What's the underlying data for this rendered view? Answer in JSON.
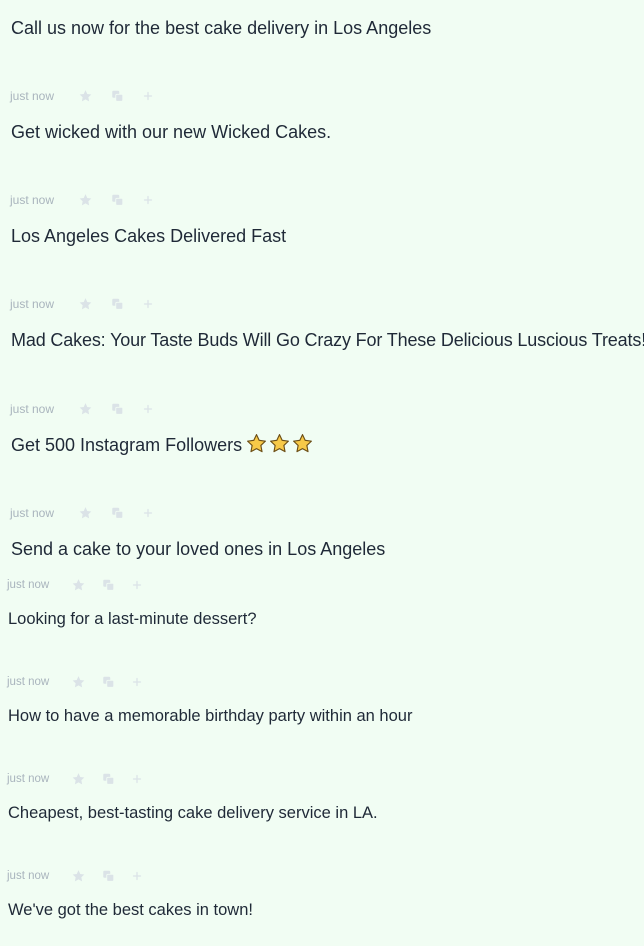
{
  "items": [
    {
      "headline": "Call us now for the best cake delivery in Los Angeles",
      "time": "just now"
    },
    {
      "headline": "Get wicked with our new Wicked Cakes.",
      "time": "just now"
    },
    {
      "headline": "Los Angeles Cakes Delivered Fast",
      "time": "just now"
    },
    {
      "headline": "Mad Cakes: Your Taste Buds Will Go Crazy For These Delicious Luscious Treats!",
      "time": "just now"
    },
    {
      "headline": "Get 500 Instagram Followers",
      "time": "just now"
    },
    {
      "headline": "Send a cake to your loved ones in Los Angeles",
      "time": "just now"
    },
    {
      "headline": "Looking for a last-minute dessert?",
      "time": "just now"
    },
    {
      "headline": "How to have a memorable birthday party within an hour",
      "time": "just now"
    },
    {
      "headline": "Cheapest, best-tasting cake delivery service in LA.",
      "time": "just now"
    },
    {
      "headline": "We've got the best cakes in town!"
    }
  ],
  "emoji_stars_count": 3,
  "colors": {
    "background": "#f1fdf3",
    "text": "#1f2937",
    "meta": "#a9b4bd",
    "icon": "#dbe3e7",
    "star_fill": "#f7c948",
    "star_stroke": "#6b4e16"
  }
}
